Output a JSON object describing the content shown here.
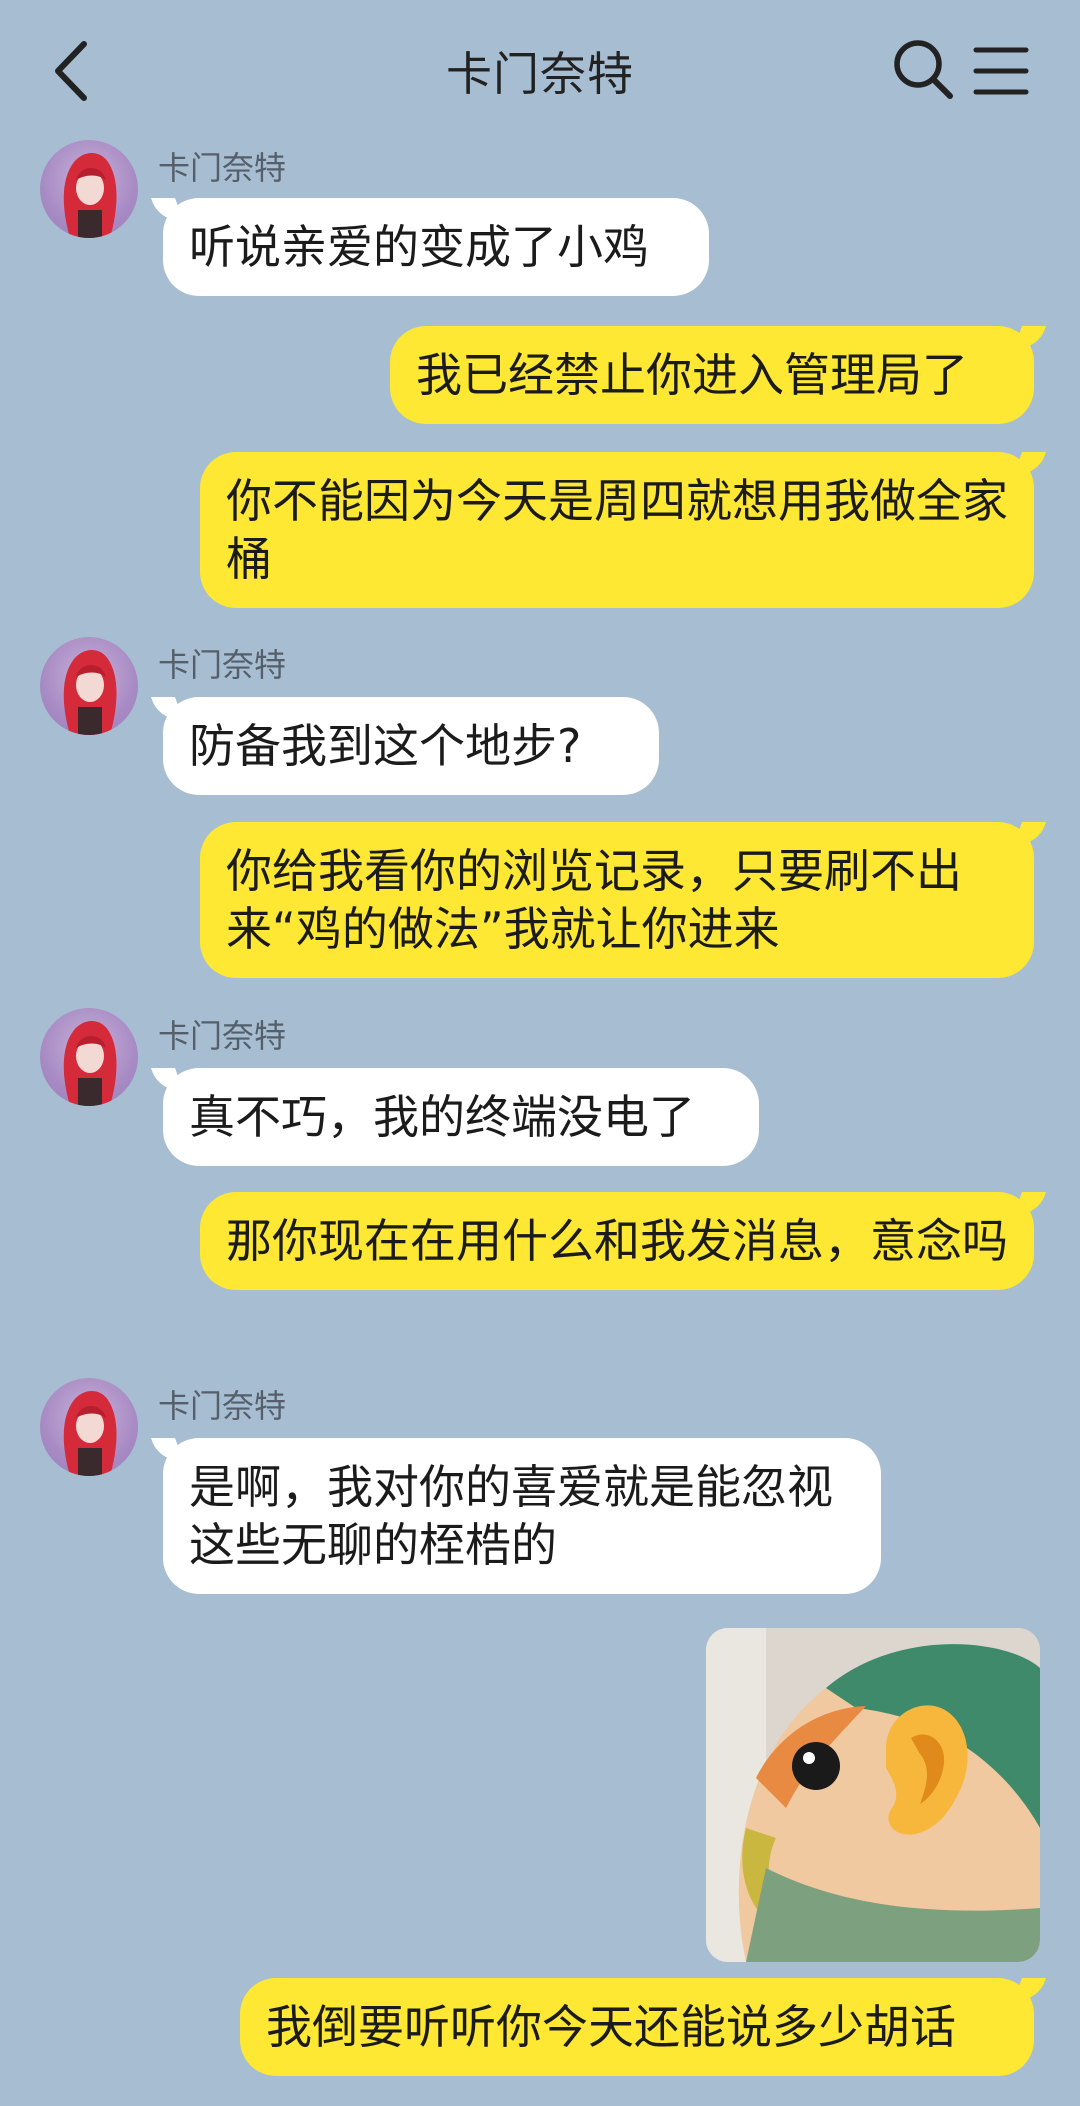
{
  "header": {
    "title": "卡门奈特",
    "back_icon": "chevron-left-icon",
    "search_icon": "search-icon",
    "menu_icon": "menu-icon"
  },
  "contact": {
    "name": "卡门奈特"
  },
  "colors": {
    "background": "#a7bdd1",
    "incoming_bubble": "#ffffff",
    "outgoing_bubble": "#fee833",
    "avatar_hair": "#d42a3a",
    "avatar_bg": "#a88bc4"
  },
  "messages": [
    {
      "side": "left",
      "sender": "卡门奈特",
      "text": "听说亲爱的变成了小鸡"
    },
    {
      "side": "right",
      "text": "我已经禁止你进入管理局了"
    },
    {
      "side": "right",
      "text": "你不能因为今天是周四就想用我做全家桶"
    },
    {
      "side": "left",
      "sender": "卡门奈特",
      "text": "防备我到这个地步?"
    },
    {
      "side": "right",
      "text": "你给我看你的浏览记录，只要刷不出来“鸡的做法”我就让你进来"
    },
    {
      "side": "left",
      "sender": "卡门奈特",
      "text": "真不巧，我的终端没电了"
    },
    {
      "side": "right",
      "text": "那你现在在用什么和我发消息，意念吗"
    },
    {
      "side": "left",
      "sender": "卡门奈特",
      "text": "是啊，我对你的喜爱就是能忽视这些无聊的桎梏的"
    },
    {
      "side": "right",
      "type": "image",
      "image": "parrot-with-ear-sticker"
    },
    {
      "side": "right",
      "text": "我倒要听听你今天还能说多少胡话"
    }
  ]
}
